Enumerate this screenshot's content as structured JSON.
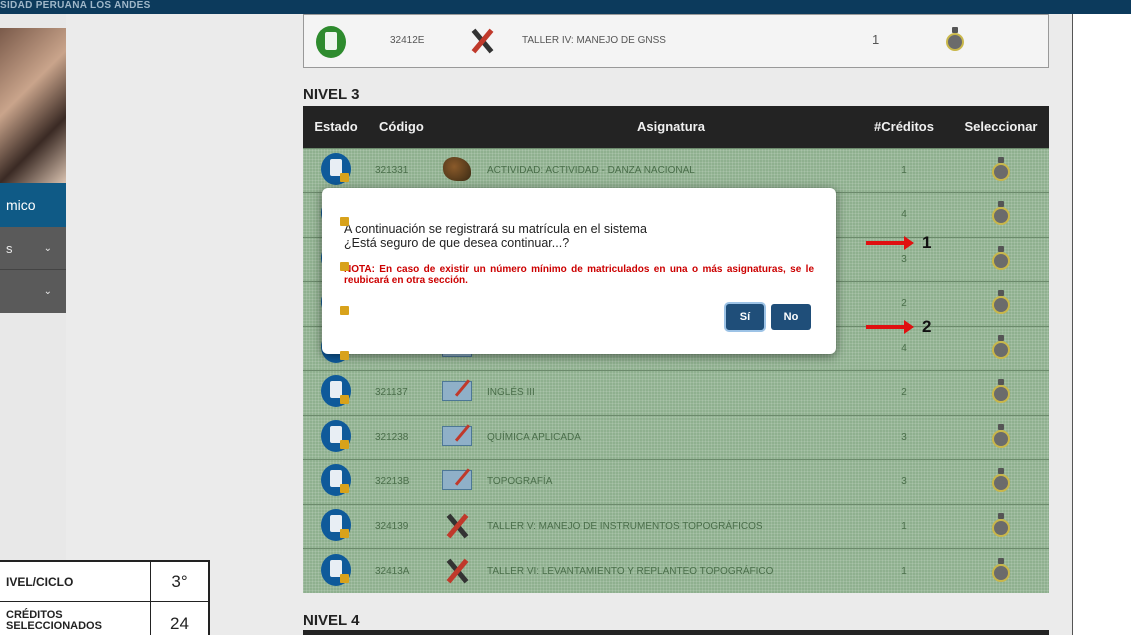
{
  "header": {
    "brand": "SIDAD PERUANA LOS ANDES"
  },
  "sidebar": {
    "items": [
      {
        "label": "mico"
      },
      {
        "label": "s"
      },
      {
        "label": ""
      }
    ]
  },
  "summary": {
    "rows": [
      {
        "label": "IVEL/CICLO",
        "value": "3°"
      },
      {
        "label": "CRÉDITOS SELECCIONADOS",
        "value": "24"
      }
    ]
  },
  "previous_row": {
    "code": "32412E",
    "name": "TALLER IV: MANEJO DE GNSS",
    "credits": "1"
  },
  "levels": {
    "level3": "NIVEL 3",
    "level4": "NIVEL 4"
  },
  "table": {
    "headers": [
      "Estado",
      "Código",
      "Asignatura",
      "#Créditos",
      "Seleccionar"
    ],
    "rows": [
      {
        "code": "321331",
        "name": "ACTIVIDAD: ACTIVIDAD - DANZA NACIONAL",
        "credits": "1",
        "icon": "dance-icon"
      },
      {
        "code": "",
        "name": "",
        "credits": "4",
        "icon": "book-icon"
      },
      {
        "code": "",
        "name": "",
        "credits": "3",
        "icon": "book-icon"
      },
      {
        "code": "",
        "name": "",
        "credits": "2",
        "icon": "book-icon"
      },
      {
        "code": "",
        "name": "",
        "credits": "4",
        "icon": "book-icon"
      },
      {
        "code": "321137",
        "name": "INGLÉS III",
        "credits": "2",
        "icon": "book-icon"
      },
      {
        "code": "321238",
        "name": "QUÍMICA APLICADA",
        "credits": "3",
        "icon": "book-icon"
      },
      {
        "code": "32213B",
        "name": "TOPOGRAFÍA",
        "credits": "3",
        "icon": "book-icon"
      },
      {
        "code": "324139",
        "name": "TALLER V: MANEJO DE INSTRUMENTOS TOPOGRÁFICOS",
        "credits": "1",
        "icon": "tools-icon"
      },
      {
        "code": "32413A",
        "name": "TALLER VI: LEVANTAMIENTO Y REPLANTEO TOPOGRÁFICO",
        "credits": "1",
        "icon": "tools-icon"
      }
    ]
  },
  "modal": {
    "line1": "A continuación se registrará su matrícula en el sistema",
    "line2": "¿Está seguro de que desea continuar...?",
    "note": "NOTA: En caso de existir un número mínimo de matriculados en una o más asignaturas, se le reubicará en otra sección.",
    "yes_label": "Sí",
    "no_label": "No"
  },
  "annotations": [
    {
      "label": "1"
    },
    {
      "label": "2"
    }
  ],
  "colors": {
    "accent": "#1f4e79",
    "row_green": "#8fb08f",
    "note_red": "#cc0000",
    "arrow_red": "#e01010"
  }
}
